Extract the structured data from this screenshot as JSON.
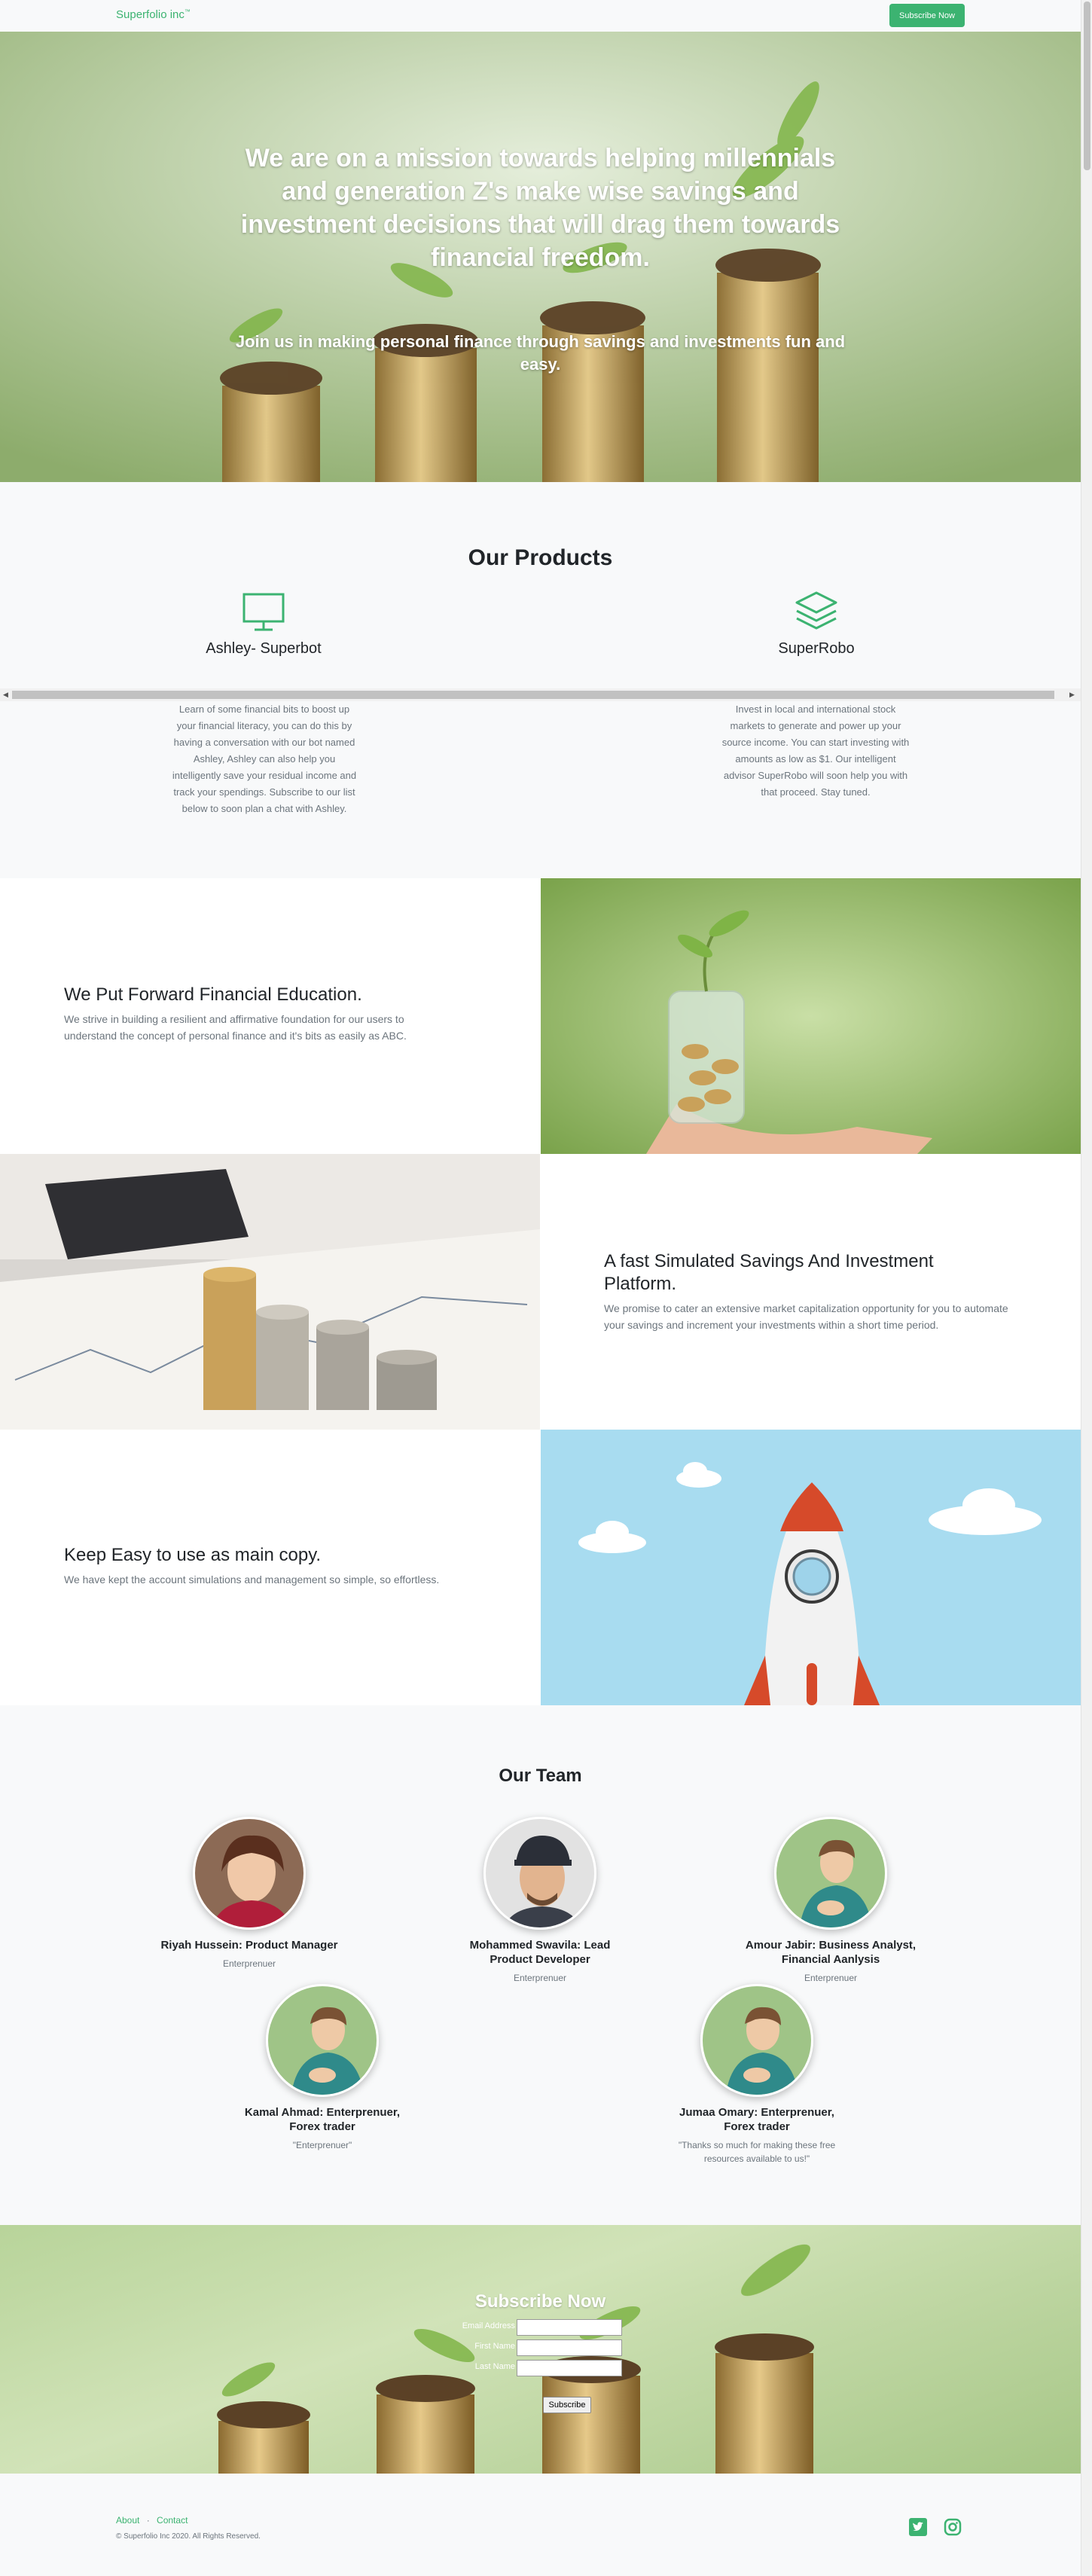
{
  "navbar": {
    "brand": "Superfolio inc",
    "brand_mark": "™",
    "subscribe_button": "Subscribe Now"
  },
  "hero": {
    "title": "We are on a mission towards helping millennials and generation Z's make wise savings and investment decisions that will drag them towards financial freedom.",
    "subtitle": "Join us in making personal finance through savings and investments fun and easy."
  },
  "products": {
    "heading": "Our Products",
    "items": [
      {
        "icon": "desktop-icon",
        "title": "Ashley- Superbot",
        "text": "Learn of some financial bits to boost up your financial literacy, you can do this by having a conversation with our bot named Ashley, Ashley can also help you intelligently save your residual income and track your spendings. Subscribe to our list below to soon plan a chat with Ashley."
      },
      {
        "icon": "layers-icon",
        "title": "SuperRobo",
        "text": "Invest in local and international stock markets to generate and power up your source income. You can start investing with amounts as low as $1. Our intelligent advisor SuperRobo will soon help you with that proceed. Stay tuned."
      }
    ]
  },
  "showcases": [
    {
      "title": "We Put Forward Financial Education.",
      "text": "We strive in building a resilient and affirmative foundation for our users to understand the concept of personal finance and it's bits as easily as ABC."
    },
    {
      "title": "A fast Simulated Savings And Investment Platform.",
      "text": "We promise to cater an extensive market capitalization opportunity for you to automate your savings and increment your investments within a short time period."
    },
    {
      "title": "Keep Easy to use as main copy.",
      "text": "We have kept the account simulations and management so simple, so effortless."
    }
  ],
  "team": {
    "heading": "Our Team",
    "members": [
      {
        "name": "Riyah Hussein: Product Manager",
        "role": "Enterprenuer"
      },
      {
        "name": "Mohammed Swavila: Lead Product Developer",
        "role": "Enterprenuer"
      },
      {
        "name": "Amour Jabir: Business Analyst, Financial Aanlysis",
        "role": "Enterprenuer"
      },
      {
        "name": "Kamal Ahmad: Enterprenuer, Forex trader",
        "role": "\"Enterprenuer\""
      },
      {
        "name": "Jumaa Omary: Enterprenuer, Forex trader",
        "role": "\"Thanks so much for making these free resources available to us!\""
      }
    ]
  },
  "subscribe": {
    "heading": "Subscribe Now",
    "email_label": "Email Address",
    "first_name_label": "First Name",
    "last_name_label": "Last Name",
    "email_value": "",
    "first_name_value": "",
    "last_name_value": "",
    "button": "Subscribe"
  },
  "footer": {
    "links": [
      "About",
      "Contact"
    ],
    "separator": "·",
    "copyright": "© Superfolio Inc 2020. All Rights Reserved.",
    "social_icons": [
      "twitter-icon",
      "instagram-icon"
    ]
  },
  "colors": {
    "brand_green": "#3cb371",
    "background": "#f8f9fa",
    "muted_text": "#6c757d",
    "sky_blue": "#a8dcf0"
  }
}
